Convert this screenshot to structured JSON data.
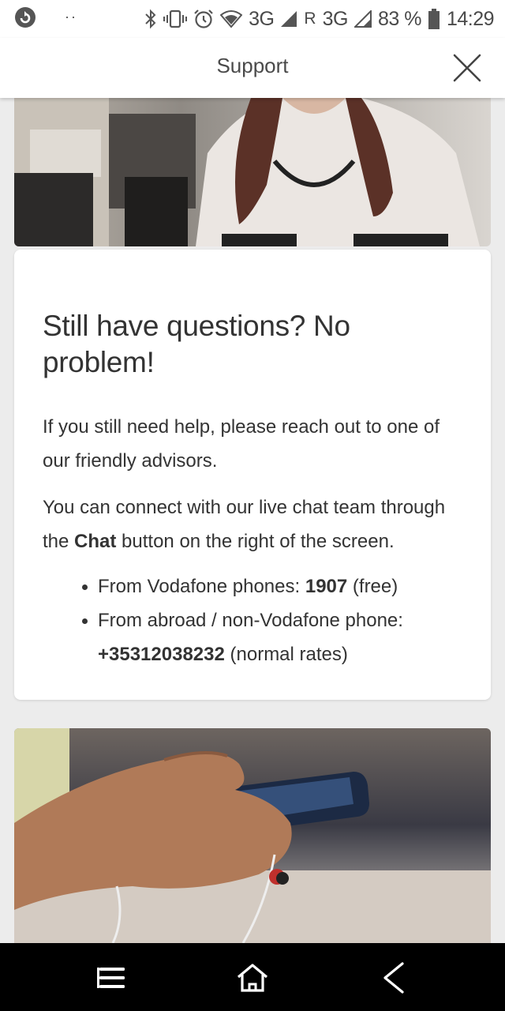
{
  "status_bar": {
    "dots": "··",
    "network_1": "3G",
    "network_2_prefix": "R",
    "network_2": "3G",
    "battery": "83 %",
    "time": "14:29"
  },
  "header": {
    "title": "Support"
  },
  "card": {
    "title": "Still have questions? No problem!",
    "para1": "If you still need help, please reach out to one of our friendly advisors.",
    "para2_before": "You can  connect with our live chat team through the ",
    "para2_bold": "Chat",
    "para2_after": " button on the right of the screen.",
    "contacts": [
      {
        "label": "From Vodafone phones: ",
        "number": "1907",
        "note": " (free)"
      },
      {
        "label": "From abroad / non-Vodafone phone: ",
        "number": "+35312038232",
        "note": " (normal rates)"
      }
    ]
  },
  "icons": {
    "close": "close-icon",
    "menu": "menu-icon",
    "home": "home-icon",
    "back": "back-icon"
  }
}
